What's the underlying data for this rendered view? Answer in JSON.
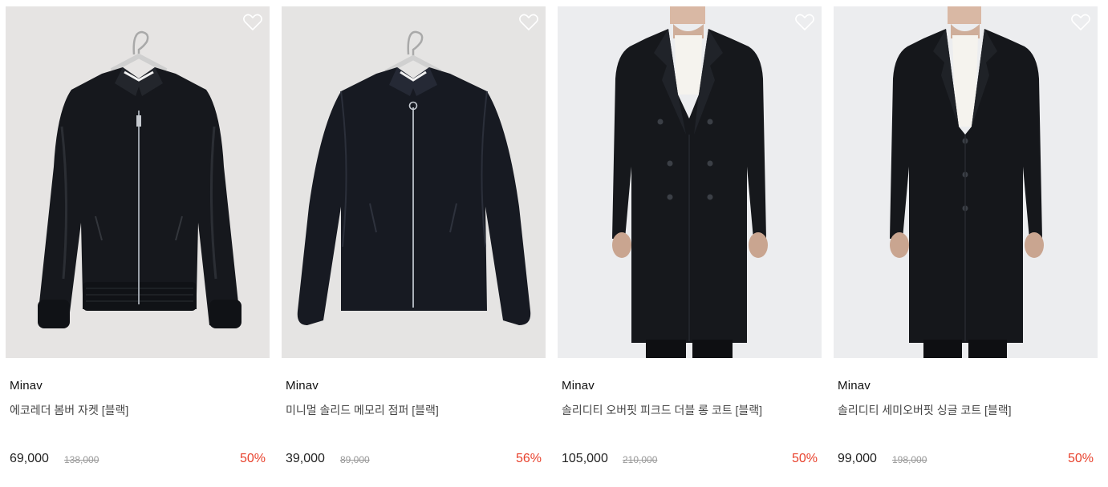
{
  "colors": {
    "discount": "#e8412c",
    "thumb_bg_jacket": "#e6e4e3",
    "thumb_bg_coat": "#ecedef",
    "garment": "#16181d"
  },
  "products": [
    {
      "brand": "Minav",
      "name": "에코레더 봄버 자켓 [블랙]",
      "price": "69,000",
      "original_price": "138,000",
      "discount": "50%",
      "image_icon": "leather-bomber-jacket"
    },
    {
      "brand": "Minav",
      "name": "미니멀 솔리드 메모리 점퍼 [블랙]",
      "price": "39,000",
      "original_price": "89,000",
      "discount": "56%",
      "image_icon": "memory-zip-jumper"
    },
    {
      "brand": "Minav",
      "name": "솔리디티 오버핏 피크드 더블 롱 코트 [블랙]",
      "price": "105,000",
      "original_price": "210,000",
      "discount": "50%",
      "image_icon": "double-breasted-long-coat"
    },
    {
      "brand": "Minav",
      "name": "솔리디티 세미오버핏 싱글 코트 [블랙]",
      "price": "99,000",
      "original_price": "198,000",
      "discount": "50%",
      "image_icon": "single-breasted-coat"
    }
  ]
}
